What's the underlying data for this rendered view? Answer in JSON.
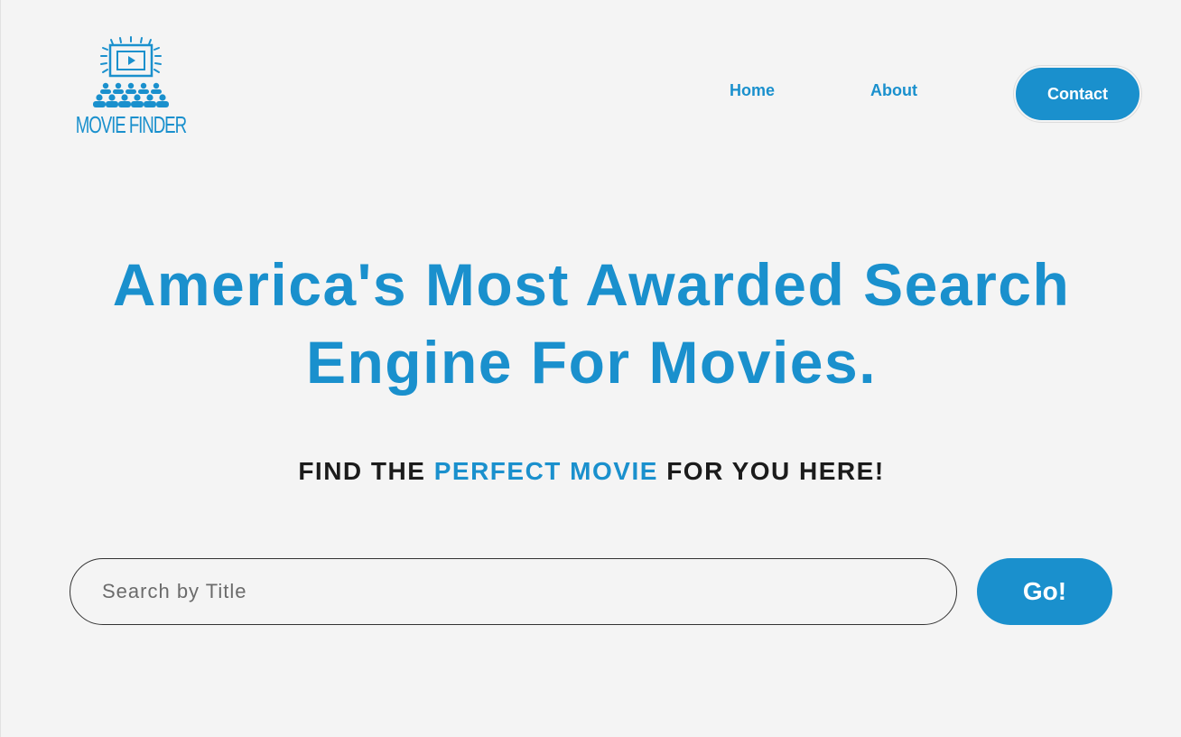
{
  "brand": {
    "logo_text": "MOVIE FINDER",
    "color": "#1a90cd",
    "icon": "movie-theater-icon"
  },
  "nav": {
    "items": [
      {
        "label": "Home"
      },
      {
        "label": "About"
      }
    ],
    "contact_label": "Contact"
  },
  "hero": {
    "headline_line1": "America's Most Awarded Search",
    "headline_line2": "Engine For Movies.",
    "tagline_pre": "FIND THE ",
    "tagline_highlight": "PERFECT MOVIE",
    "tagline_post": " FOR YOU HERE!"
  },
  "search": {
    "placeholder": "Search by Title",
    "value": "",
    "button_label": "Go!"
  },
  "colors": {
    "accent": "#1a90cd",
    "background": "#f4f4f4",
    "text_dark": "#1b1b1b"
  }
}
